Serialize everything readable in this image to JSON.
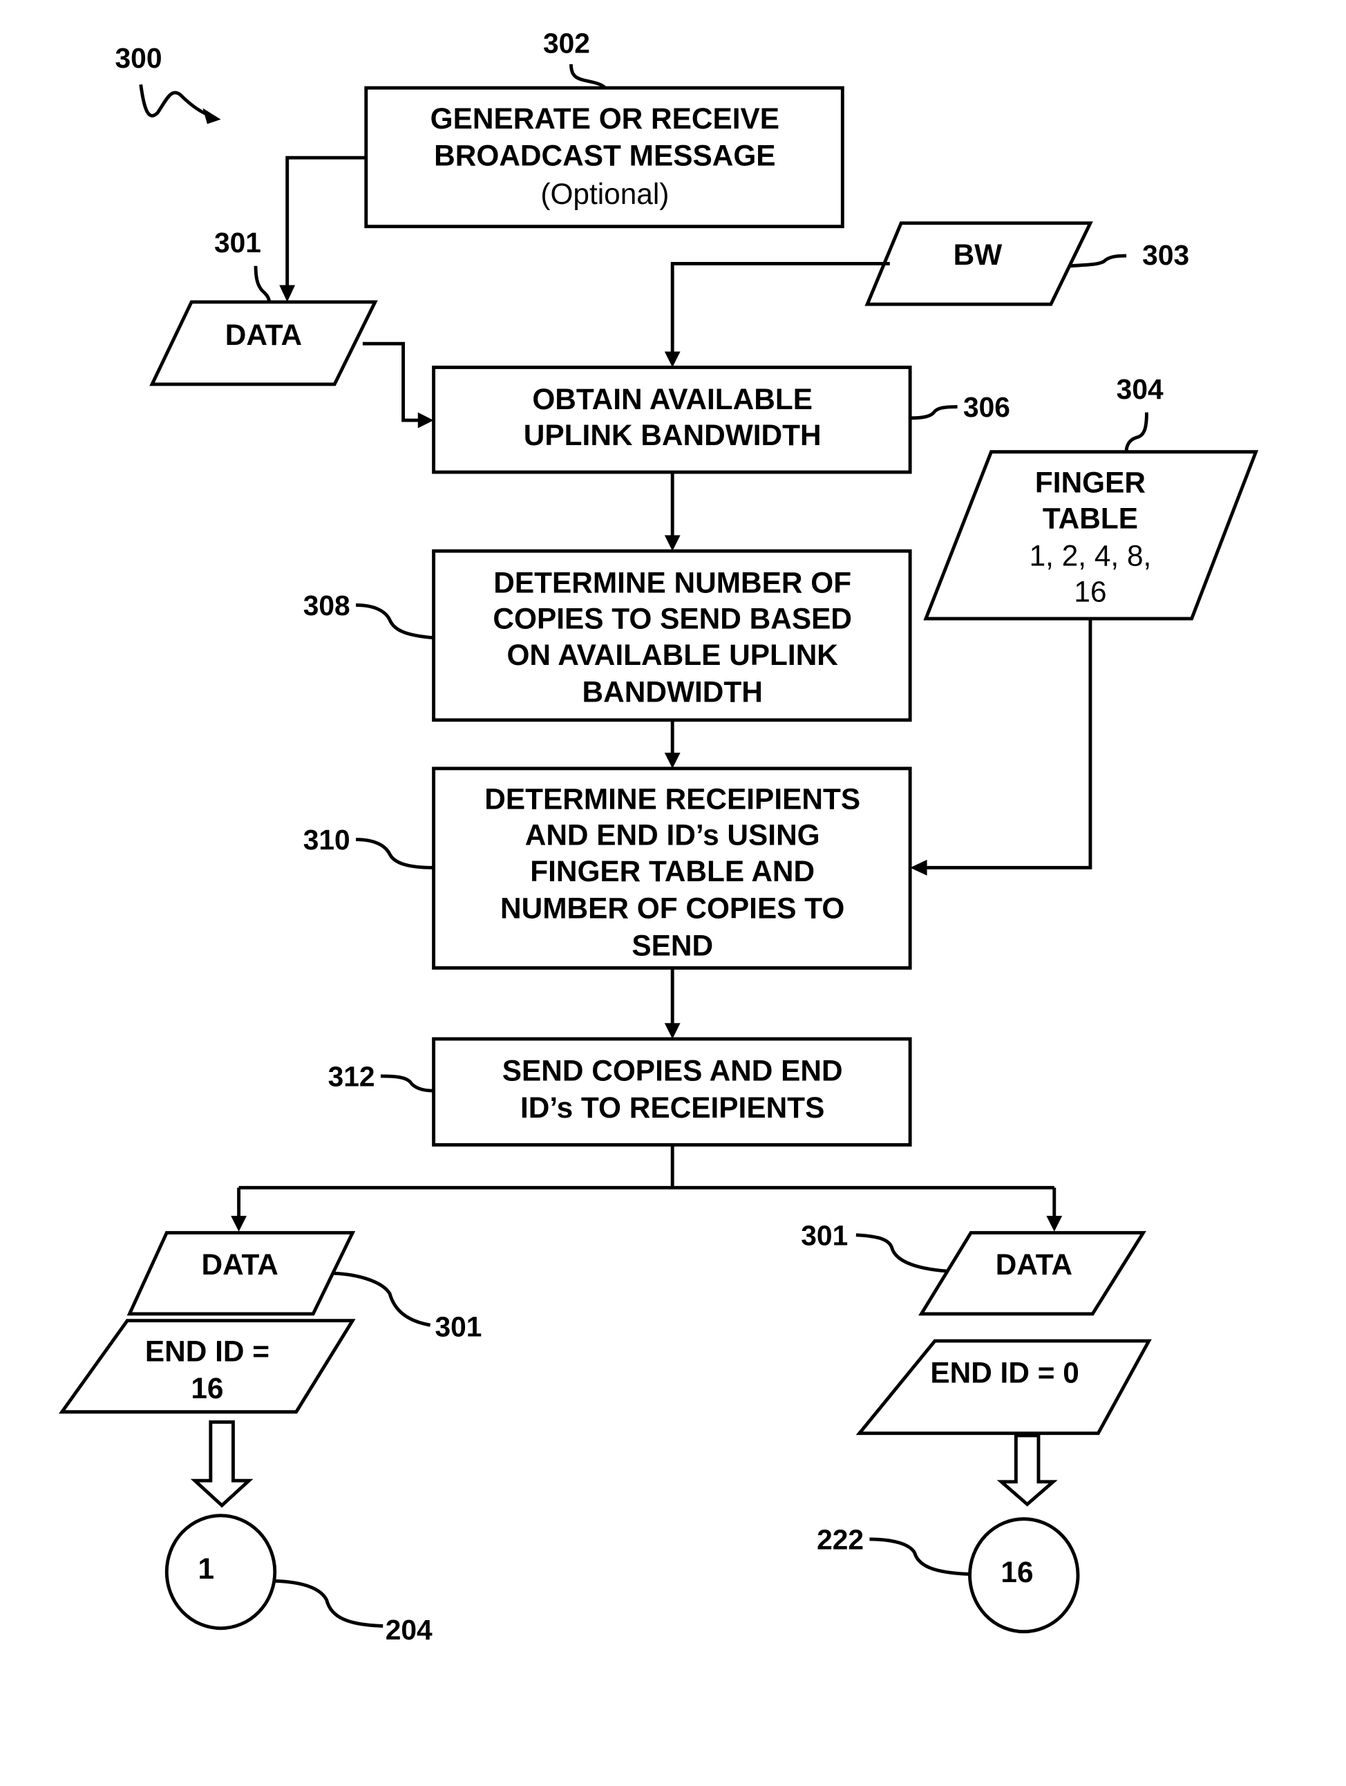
{
  "figure": {
    "ref": "300",
    "nodes": {
      "generate": {
        "ref": "302",
        "lines": [
          "GENERATE OR RECEIVE",
          "BROADCAST MESSAGE",
          "(Optional)"
        ]
      },
      "data_in": {
        "ref": "301",
        "lines": [
          "DATA"
        ]
      },
      "bw": {
        "ref": "303",
        "lines": [
          "BW"
        ]
      },
      "obtain": {
        "ref": "306",
        "lines": [
          "OBTAIN AVAILABLE",
          "UPLINK BANDWIDTH"
        ]
      },
      "finger_table": {
        "ref": "304",
        "lines": [
          "FINGER",
          "TABLE",
          "1, 2, 4, 8,",
          "16"
        ]
      },
      "determine_copies": {
        "ref": "308",
        "lines": [
          "DETERMINE NUMBER OF",
          "COPIES TO SEND BASED",
          "ON AVAILABLE UPLINK",
          "BANDWIDTH"
        ]
      },
      "determine_recipients": {
        "ref": "310",
        "lines": [
          "DETERMINE RECEIPIENTS",
          "AND END ID’s USING",
          "FINGER TABLE AND",
          "NUMBER OF COPIES TO",
          "SEND"
        ]
      },
      "send": {
        "ref": "312",
        "lines": [
          "SEND COPIES AND END",
          "ID’s TO RECEIPIENTS"
        ]
      },
      "left_data": {
        "ref": "301",
        "lines": [
          "DATA"
        ]
      },
      "left_endid": {
        "lines": [
          "END ID =",
          "16"
        ]
      },
      "left_node": {
        "ref": "204",
        "label": "1"
      },
      "right_data": {
        "ref": "301",
        "lines": [
          "DATA"
        ]
      },
      "right_endid": {
        "lines": [
          "END ID = 0"
        ]
      },
      "right_node": {
        "ref": "222",
        "label": "16"
      }
    }
  }
}
